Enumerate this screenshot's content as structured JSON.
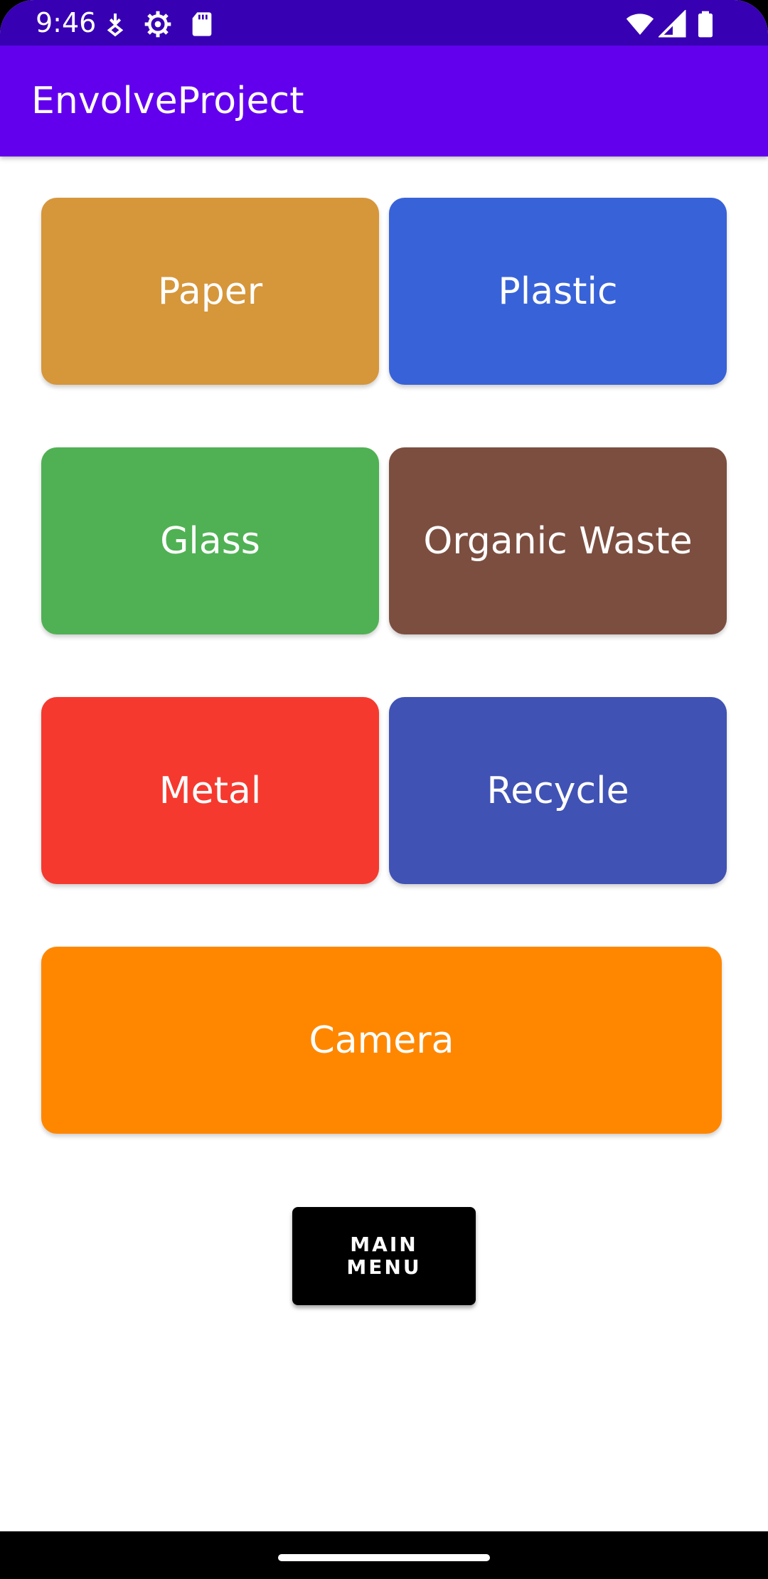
{
  "status_bar": {
    "time": "9:46",
    "icons": [
      "download-icon",
      "settings-gear-icon",
      "sd-card-icon",
      "wifi-icon",
      "cellular-signal-icon",
      "battery-icon"
    ],
    "background": "#3700b3"
  },
  "app_bar": {
    "title": "EnvolveProject",
    "background": "#6200ee"
  },
  "categories": [
    {
      "label": "Paper",
      "color": "#d6963a"
    },
    {
      "label": "Plastic",
      "color": "#3862d8"
    },
    {
      "label": "Glass",
      "color": "#4fb153"
    },
    {
      "label": "Organic Waste",
      "color": "#7c4e40"
    },
    {
      "label": "Metal",
      "color": "#f6392e"
    },
    {
      "label": "Recycle",
      "color": "#4052b4"
    }
  ],
  "camera_button": {
    "label": "Camera",
    "color": "#ff8700"
  },
  "main_menu_button": {
    "label": "MAIN\nMENU",
    "color": "#000000"
  }
}
